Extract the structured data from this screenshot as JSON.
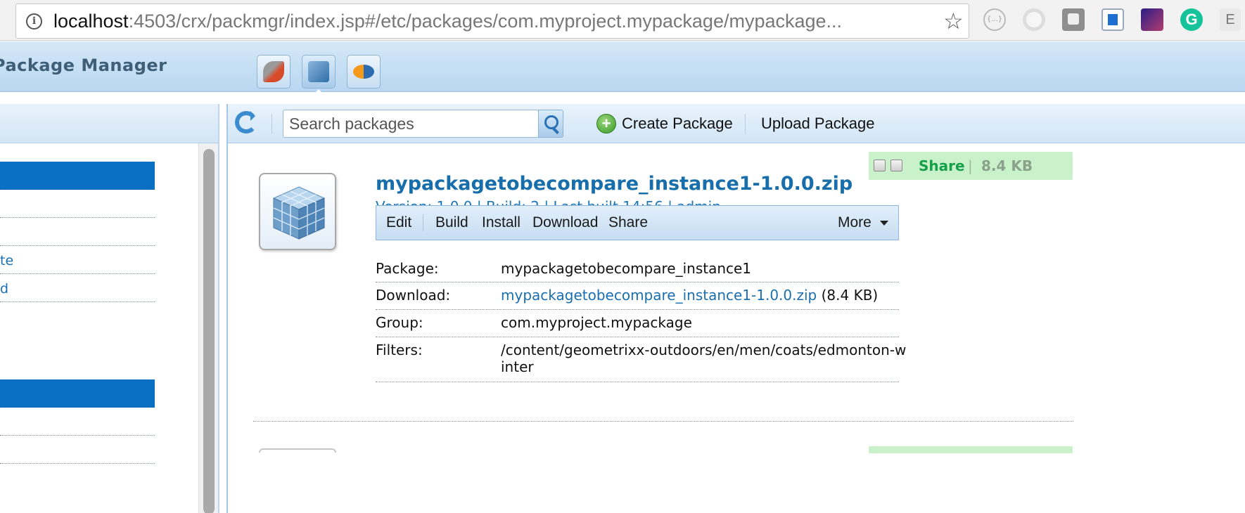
{
  "browser": {
    "url_host": "localhost",
    "url_path": ":4503/crx/packmgr/index.jsp#/etc/packages/com.myproject.mypackage/mypackage...",
    "info_icon": "info-icon",
    "bookmark_icon": "star-icon",
    "extensions": [
      {
        "name": "json-viewer-icon",
        "label": "{...}"
      },
      {
        "name": "opera-icon",
        "label": ""
      },
      {
        "name": "window-icon",
        "label": ""
      },
      {
        "name": "bookmark-manager-icon",
        "label": ""
      },
      {
        "name": "night-sky-icon",
        "label": ""
      },
      {
        "name": "grammarly-icon",
        "label": "G"
      },
      {
        "name": "extension-e-icon",
        "label": "E"
      }
    ]
  },
  "app": {
    "title": "Package Manager",
    "tools": [
      {
        "name": "tools-icon"
      },
      {
        "name": "packages-icon"
      },
      {
        "name": "share-icon"
      }
    ]
  },
  "toolbar": {
    "search_placeholder": "Search packages",
    "create_label": "Create Package",
    "upload_label": "Upload Package"
  },
  "tree": {
    "rows": [
      {
        "label": "",
        "selected": true
      },
      {
        "label": "",
        "selected": false
      },
      {
        "label": "",
        "selected": false
      },
      {
        "label": "te",
        "selected": false
      },
      {
        "label": "d",
        "selected": false
      },
      {
        "label": "",
        "selected": false
      },
      {
        "label": "",
        "selected": true
      },
      {
        "label": "",
        "selected": false
      },
      {
        "label": "",
        "selected": false
      }
    ]
  },
  "package": {
    "title": "mypackagetobecompare_instance1-1.0.0.zip",
    "meta": "Version: 1.0.0 | Build: 2 | Last built 14:56 | admin",
    "share_label": "Share",
    "share_sep": "|",
    "share_size": "8.4 KB",
    "actions": {
      "edit": "Edit",
      "build": "Build",
      "install": "Install",
      "download": "Download",
      "share": "Share",
      "more": "More"
    },
    "details": {
      "package_key": "Package:",
      "package_value": "mypackagetobecompare_instance1",
      "download_key": "Download:",
      "download_link": "mypackagetobecompare_instance1-1.0.0.zip",
      "download_size": "(8.4 KB)",
      "group_key": "Group:",
      "group_value": "com.myproject.mypackage",
      "filters_key": "Filters:",
      "filters_value": "/content/geometrixx-outdoors/en/men/coats/edmonton-winter"
    }
  },
  "colors": {
    "link_blue": "#176eaa",
    "selection_blue": "#0a70c4",
    "share_green": "#17a04a",
    "share_bg": "#c9f2cb",
    "header_blue": "#b9d7f1"
  }
}
